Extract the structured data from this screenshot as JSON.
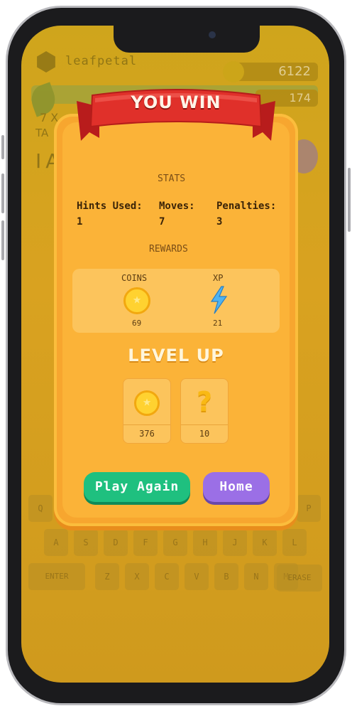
{
  "background": {
    "brand": "leafpetal",
    "coins": "6122",
    "progress_value": "174",
    "line1": "7 X",
    "line2": "TA",
    "word": "IA",
    "keyboard": {
      "row1": [
        "Q",
        "P"
      ],
      "row2": [
        "A",
        "S",
        "D",
        "F",
        "G",
        "H",
        "J",
        "K",
        "L"
      ],
      "row3": [
        "ENTER",
        "Z",
        "X",
        "C",
        "V",
        "B",
        "N",
        "M",
        "ERASE"
      ]
    }
  },
  "modal": {
    "banner": "YOU WIN",
    "stats_title": "STATS",
    "stats": [
      {
        "label": "Hints Used:",
        "value": "1"
      },
      {
        "label": "Moves:",
        "value": "7"
      },
      {
        "label": "Penalties:",
        "value": "3"
      }
    ],
    "rewards_title": "REWARDS",
    "rewards": [
      {
        "label": "COINS",
        "value": "69",
        "icon": "coin-icon"
      },
      {
        "label": "XP",
        "value": "21",
        "icon": "lightning-icon"
      }
    ],
    "level_up_title": "LEVEL UP",
    "level_up": [
      {
        "value": "376",
        "icon": "coin-icon"
      },
      {
        "value": "10",
        "icon": "question-icon"
      }
    ],
    "play_again_label": "Play Again",
    "home_label": "Home"
  },
  "colors": {
    "modal": "#f7a62f",
    "ribbon": "#e0302a",
    "play": "#1fc07f",
    "home": "#9b6fe6"
  }
}
